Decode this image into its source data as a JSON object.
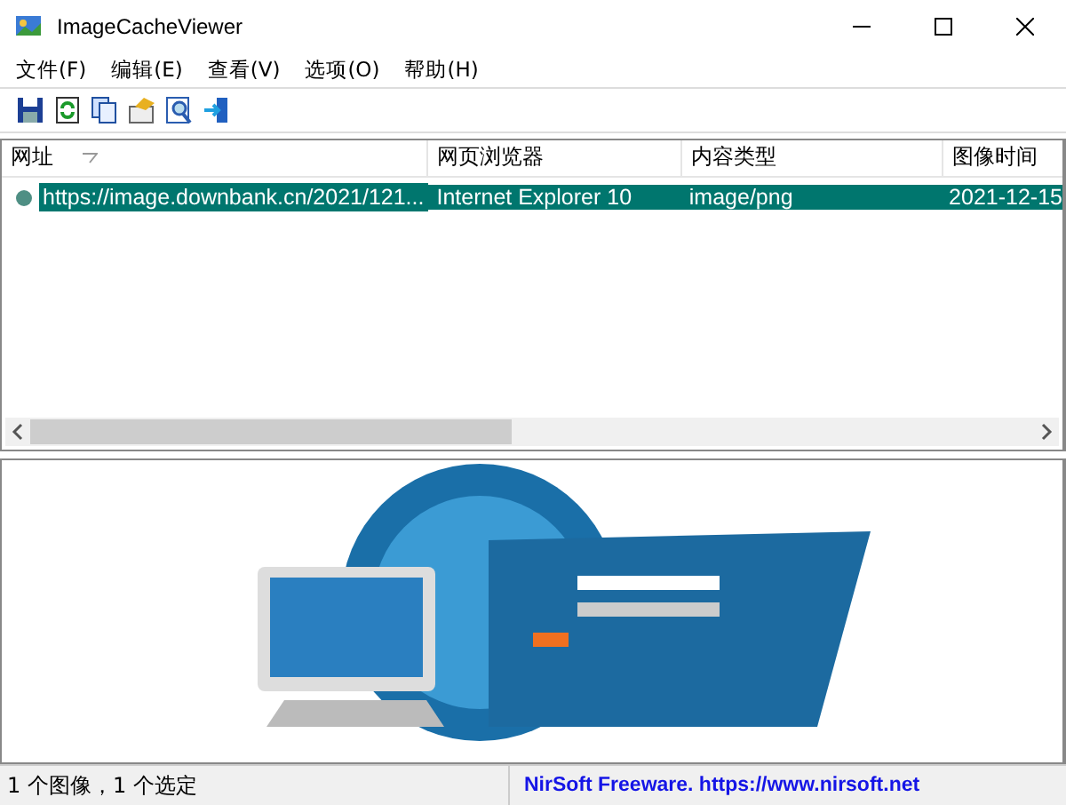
{
  "window": {
    "title": "ImageCacheViewer"
  },
  "menu": [
    "文件(F)",
    "编辑(E)",
    "查看(V)",
    "选项(O)",
    "帮助(H)"
  ],
  "toolbar": [
    {
      "kind": "save"
    },
    {
      "kind": "refresh"
    },
    {
      "kind": "copy"
    },
    {
      "kind": "properties"
    },
    {
      "kind": "find"
    },
    {
      "kind": "exit"
    }
  ],
  "table": {
    "columns": [
      {
        "label": "网址",
        "sorted": true
      },
      {
        "label": "网页浏览器",
        "sorted": false
      },
      {
        "label": "内容类型",
        "sorted": false
      },
      {
        "label": "图像时间",
        "sorted": false
      }
    ],
    "rows": [
      {
        "selected": true,
        "cells": [
          "https://image.downbank.cn/2021/121...",
          "Internet Explorer 10",
          "image/png",
          "2021-12-15"
        ]
      }
    ]
  },
  "status_bar": {
    "summary": "1 个图像，1 个选定",
    "link": "NirSoft Freeware. https://www.nirsoft.net"
  }
}
